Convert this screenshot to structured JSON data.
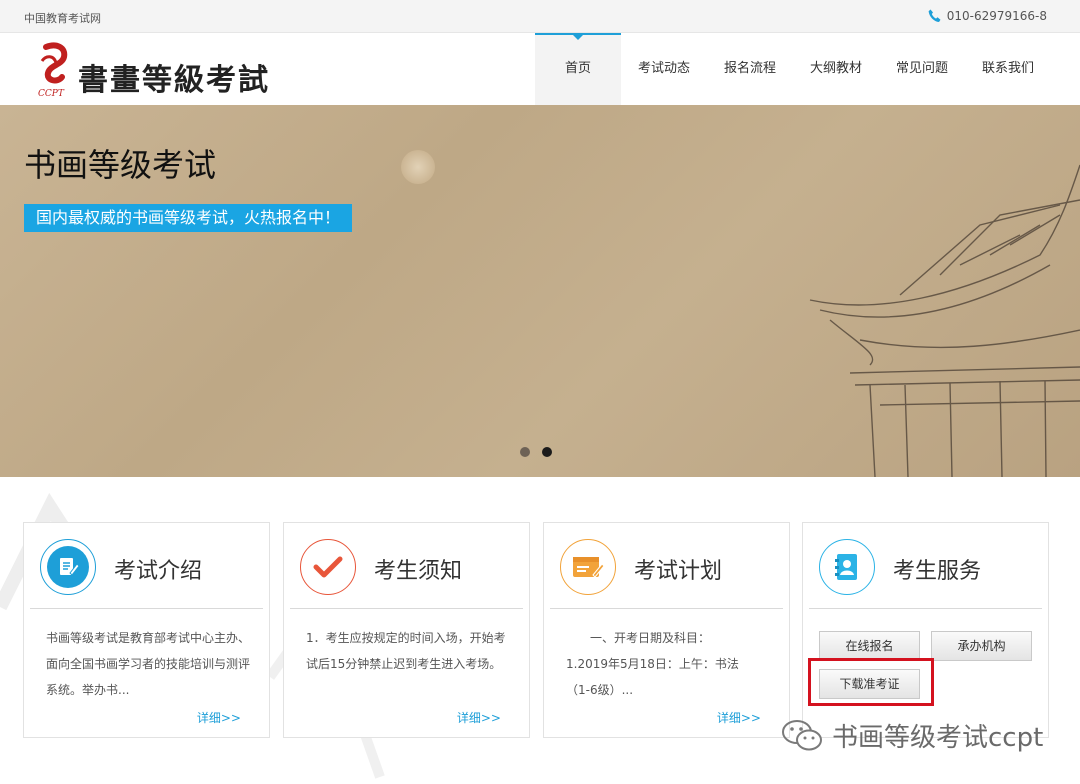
{
  "topbar": {
    "site_name": "中国教育考试网",
    "phone": "010-62979166-8"
  },
  "header": {
    "logo_text": "書畫等級考試",
    "logo_sub": "CCPT"
  },
  "nav": {
    "items": [
      {
        "label": "首页",
        "active": true
      },
      {
        "label": "考试动态",
        "active": false
      },
      {
        "label": "报名流程",
        "active": false
      },
      {
        "label": "大纲教材",
        "active": false
      },
      {
        "label": "常见问题",
        "active": false
      },
      {
        "label": "联系我们",
        "active": false
      }
    ]
  },
  "banner": {
    "title": "书画等级考试",
    "tagline": "国内最权威的书画等级考试，火热报名中！",
    "slide_count": 2,
    "active_slide": 2
  },
  "cards": [
    {
      "title": "考试介绍",
      "icon": "document-edit-icon",
      "color": "#1e9fd8",
      "body": "书画等级考试是教育部考试中心主办、面向全国书画学习者的技能培训与测评系统。举办书...",
      "more": "详细>>"
    },
    {
      "title": "考生须知",
      "icon": "checkmark-icon",
      "color": "#e8563a",
      "body": "1．考生应按规定的时间入场，开始考试后15分钟禁止迟到考生进入考场。",
      "more": "详细>>"
    },
    {
      "title": "考试计划",
      "icon": "schedule-board-icon",
      "color": "#f2a33a",
      "body_lines": [
        "一、开考日期及科目：",
        "1.2019年5月18日：上午：书法",
        "（1-6级）..."
      ],
      "more": "详细>>"
    },
    {
      "title": "考生服务",
      "icon": "address-book-icon",
      "color": "#2bb3e6",
      "buttons": [
        "在线报名",
        "承办机构",
        "下载准考证"
      ]
    }
  ],
  "watermark": {
    "text": "书画等级考试ccpt",
    "icon": "wechat-icon"
  },
  "colors": {
    "accent": "#1e9fd8",
    "highlight": "#d4121f"
  }
}
